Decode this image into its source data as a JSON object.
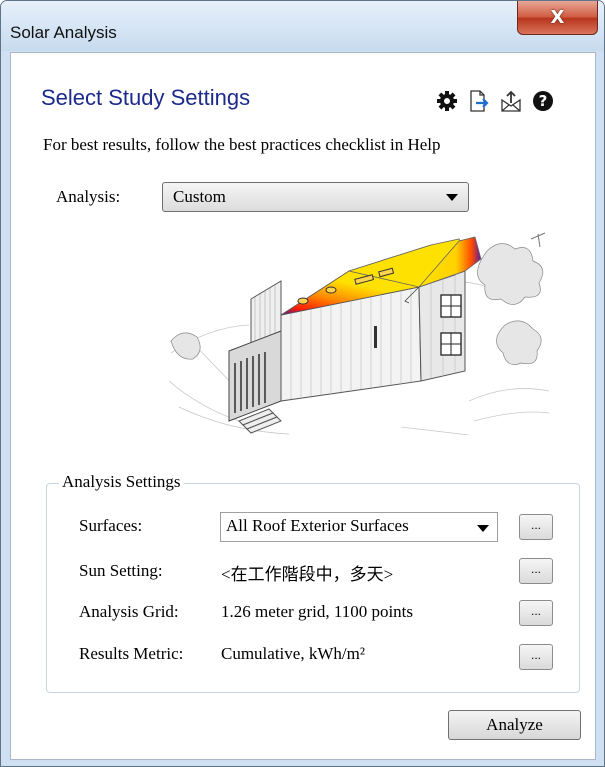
{
  "window": {
    "title": "Solar Analysis",
    "close_label": "X"
  },
  "heading": "Select Study Settings",
  "toolbar": {
    "icons": [
      "gear-icon",
      "export-icon",
      "share-icon",
      "help-icon"
    ],
    "help_label": "?"
  },
  "intro": "For best results, follow the best practices checklist in Help",
  "analysis": {
    "label": "Analysis:",
    "value": "Custom"
  },
  "settings": {
    "title": "Analysis Settings",
    "surfaces": {
      "label": "Surfaces:",
      "value": "All Roof Exterior Surfaces"
    },
    "sun": {
      "label": "Sun Setting:",
      "value": "<在工作階段中，多天>"
    },
    "grid": {
      "label": "Analysis Grid:",
      "value": "1.26 meter grid, 1100 points"
    },
    "metric": {
      "label": "Results Metric:",
      "value": "Cumulative, kWh/m²"
    },
    "browse_label": "..."
  },
  "analyze_label": "Analyze",
  "colors": {
    "heading": "#1c2a8c",
    "heat_high": "#ffe100",
    "heat_mid": "#ff3c00",
    "heat_low": "#5a1ea0"
  }
}
